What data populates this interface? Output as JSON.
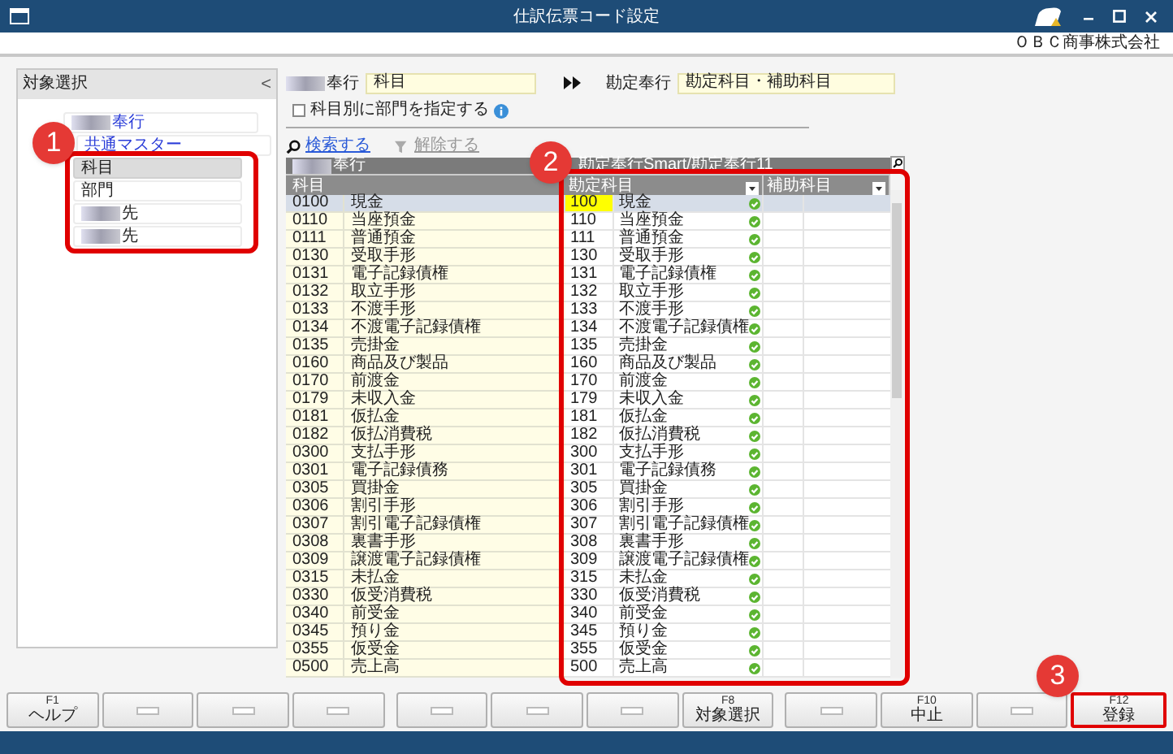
{
  "window": {
    "title": "仕訳伝票コード設定"
  },
  "company": "ＯＢＣ商事株式会社",
  "sidebar": {
    "title": "対象選択",
    "collapse": "<",
    "items": [
      {
        "label": "奉行",
        "redacted": true,
        "selected": false,
        "children": [
          {
            "label": "共通マスター",
            "redacted": false,
            "selected": false,
            "children": [
              {
                "label": "科目",
                "redacted": false,
                "selected": true
              },
              {
                "label": "部門",
                "redacted": false,
                "selected": false
              },
              {
                "label": "先",
                "redacted": true,
                "selected": false
              },
              {
                "label": "先",
                "redacted": true,
                "selected": false
              }
            ]
          }
        ]
      }
    ]
  },
  "source": {
    "label": "奉行",
    "value": "科目"
  },
  "target": {
    "label": "勘定奉行",
    "value": "勘定科目・補助科目"
  },
  "dept_option": {
    "label": "科目別に部門を指定する",
    "checked": false
  },
  "search_link": {
    "label": "検索する",
    "disabled": false
  },
  "clear_link": {
    "label": "解除する",
    "disabled": true
  },
  "source_grid": {
    "group": "奉行",
    "column": "科目"
  },
  "target_grid": {
    "group": "勘定奉行Smart/勘定奉行11",
    "columns": [
      "勘定科目",
      "補助科目"
    ]
  },
  "rows": [
    {
      "code": "0100",
      "name": "現金",
      "target_code": "100",
      "target_name": "現金",
      "matched": true,
      "selected": true
    },
    {
      "code": "0110",
      "name": "当座預金",
      "target_code": "110",
      "target_name": "当座預金",
      "matched": true,
      "selected": false
    },
    {
      "code": "0111",
      "name": "普通預金",
      "target_code": "111",
      "target_name": "普通預金",
      "matched": true,
      "selected": false
    },
    {
      "code": "0130",
      "name": "受取手形",
      "target_code": "130",
      "target_name": "受取手形",
      "matched": true,
      "selected": false
    },
    {
      "code": "0131",
      "name": "電子記録債権",
      "target_code": "131",
      "target_name": "電子記録債権",
      "matched": true,
      "selected": false
    },
    {
      "code": "0132",
      "name": "取立手形",
      "target_code": "132",
      "target_name": "取立手形",
      "matched": true,
      "selected": false
    },
    {
      "code": "0133",
      "name": "不渡手形",
      "target_code": "133",
      "target_name": "不渡手形",
      "matched": true,
      "selected": false
    },
    {
      "code": "0134",
      "name": "不渡電子記録債権",
      "target_code": "134",
      "target_name": "不渡電子記録債権",
      "matched": true,
      "selected": false
    },
    {
      "code": "0135",
      "name": "売掛金",
      "target_code": "135",
      "target_name": "売掛金",
      "matched": true,
      "selected": false
    },
    {
      "code": "0160",
      "name": "商品及び製品",
      "target_code": "160",
      "target_name": "商品及び製品",
      "matched": true,
      "selected": false
    },
    {
      "code": "0170",
      "name": "前渡金",
      "target_code": "170",
      "target_name": "前渡金",
      "matched": true,
      "selected": false
    },
    {
      "code": "0179",
      "name": "未収入金",
      "target_code": "179",
      "target_name": "未収入金",
      "matched": true,
      "selected": false
    },
    {
      "code": "0181",
      "name": "仮払金",
      "target_code": "181",
      "target_name": "仮払金",
      "matched": true,
      "selected": false
    },
    {
      "code": "0182",
      "name": "仮払消費税",
      "target_code": "182",
      "target_name": "仮払消費税",
      "matched": true,
      "selected": false
    },
    {
      "code": "0300",
      "name": "支払手形",
      "target_code": "300",
      "target_name": "支払手形",
      "matched": true,
      "selected": false
    },
    {
      "code": "0301",
      "name": "電子記録債務",
      "target_code": "301",
      "target_name": "電子記録債務",
      "matched": true,
      "selected": false
    },
    {
      "code": "0305",
      "name": "買掛金",
      "target_code": "305",
      "target_name": "買掛金",
      "matched": true,
      "selected": false
    },
    {
      "code": "0306",
      "name": "割引手形",
      "target_code": "306",
      "target_name": "割引手形",
      "matched": true,
      "selected": false
    },
    {
      "code": "0307",
      "name": "割引電子記録債権",
      "target_code": "307",
      "target_name": "割引電子記録債権",
      "matched": true,
      "selected": false
    },
    {
      "code": "0308",
      "name": "裏書手形",
      "target_code": "308",
      "target_name": "裏書手形",
      "matched": true,
      "selected": false
    },
    {
      "code": "0309",
      "name": "譲渡電子記録債権",
      "target_code": "309",
      "target_name": "譲渡電子記録債権",
      "matched": true,
      "selected": false
    },
    {
      "code": "0315",
      "name": "未払金",
      "target_code": "315",
      "target_name": "未払金",
      "matched": true,
      "selected": false
    },
    {
      "code": "0330",
      "name": "仮受消費税",
      "target_code": "330",
      "target_name": "仮受消費税",
      "matched": true,
      "selected": false
    },
    {
      "code": "0340",
      "name": "前受金",
      "target_code": "340",
      "target_name": "前受金",
      "matched": true,
      "selected": false
    },
    {
      "code": "0345",
      "name": "預り金",
      "target_code": "345",
      "target_name": "預り金",
      "matched": true,
      "selected": false
    },
    {
      "code": "0355",
      "name": "仮受金",
      "target_code": "355",
      "target_name": "仮受金",
      "matched": true,
      "selected": false
    },
    {
      "code": "0500",
      "name": "売上高",
      "target_code": "500",
      "target_name": "売上高",
      "matched": true,
      "selected": false
    }
  ],
  "function_keys": [
    {
      "key": "F1",
      "label": "ヘルプ",
      "highlighted": false
    },
    {
      "highlighted": false
    },
    {
      "highlighted": false
    },
    {
      "highlighted": false
    },
    {
      "highlighted": false
    },
    {
      "highlighted": false
    },
    {
      "highlighted": false
    },
    {
      "key": "F8",
      "label": "対象選択",
      "highlighted": false
    },
    {
      "highlighted": false
    },
    {
      "key": "F10",
      "label": "中止",
      "highlighted": false
    },
    {
      "highlighted": false
    },
    {
      "key": "F12",
      "label": "登録",
      "highlighted": true
    }
  ],
  "callouts": [
    "1",
    "2",
    "3"
  ]
}
